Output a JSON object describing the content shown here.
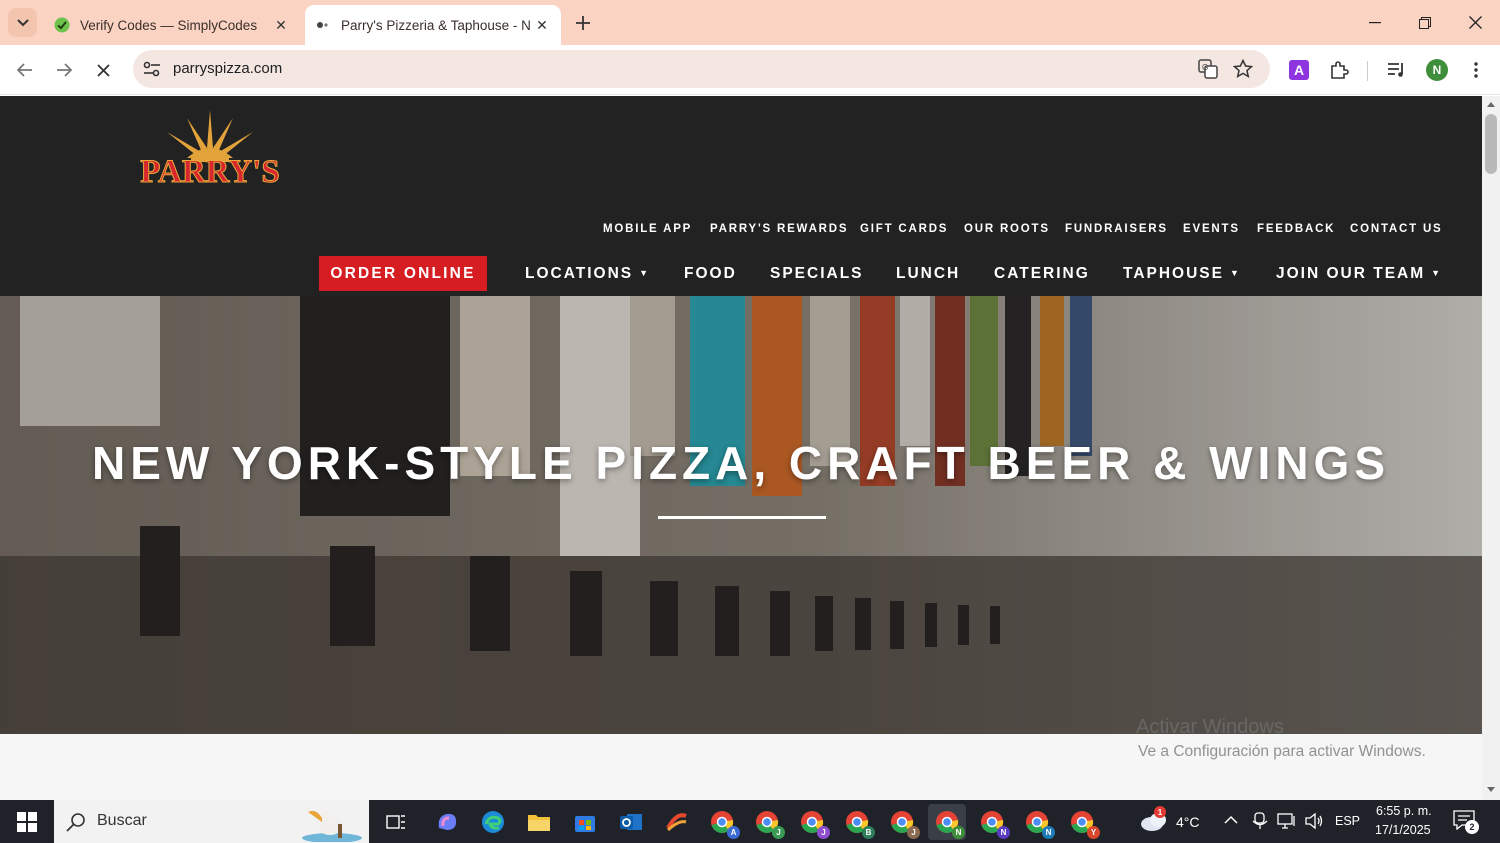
{
  "browser": {
    "tabs": [
      {
        "title": "Verify Codes — SimplyCodes",
        "active": false
      },
      {
        "title": "Parry's Pizzeria & Taphouse - New",
        "active": true
      }
    ],
    "url": "parryspizza.com",
    "profile_initial": "N",
    "extension_letter": "A"
  },
  "site": {
    "logo_text": "PARRY'S",
    "top_nav": [
      "MOBILE APP",
      "PARRY'S REWARDS",
      "GIFT CARDS",
      "OUR ROOTS",
      "FUNDRAISERS",
      "EVENTS",
      "FEEDBACK",
      "CONTACT US"
    ],
    "order_online": "ORDER ONLINE",
    "main_nav": [
      "LOCATIONS",
      "FOOD",
      "SPECIALS",
      "LUNCH",
      "CATERING",
      "TAPHOUSE",
      "JOIN OUR TEAM"
    ],
    "hero_headline": "NEW YORK-STYLE PIZZA, CRAFT BEER & WINGS"
  },
  "watermark": {
    "line1": "Activar Windows",
    "line2": "Ve a Configuración para activar Windows."
  },
  "taskbar": {
    "search_placeholder": "Buscar",
    "weather": "4°C",
    "weather_badge": "1",
    "language": "ESP",
    "time": "6:55 p. m.",
    "date": "17/1/2025",
    "notifications": "2",
    "chrome_profiles": [
      "A",
      "J",
      "J",
      "B",
      "J",
      "N",
      "N",
      "N",
      "Y"
    ]
  },
  "colors": {
    "accent_red": "#d51d22",
    "header_bg": "#222222",
    "tab_strip": "#fad3c2"
  }
}
